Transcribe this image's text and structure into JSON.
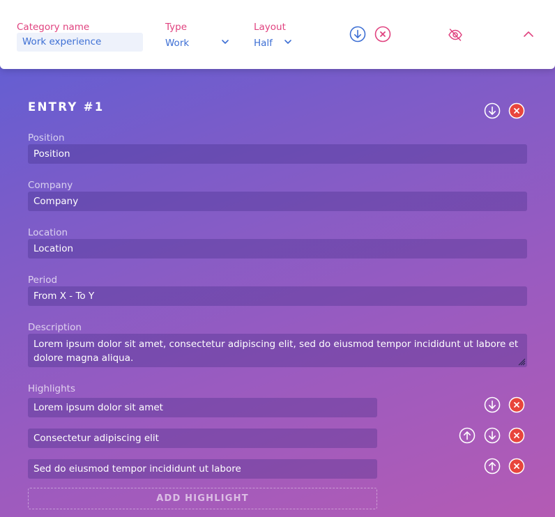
{
  "category": {
    "name_label": "Category name",
    "name_value": "Work experience",
    "type_label": "Type",
    "type_value": "Work",
    "layout_label": "Layout",
    "layout_value": "Half"
  },
  "entry": {
    "title": "ENTRY #1",
    "fields": {
      "position": {
        "label": "Position",
        "value": "Position"
      },
      "company": {
        "label": "Company",
        "value": "Company"
      },
      "location": {
        "label": "Location",
        "value": "Location"
      },
      "period": {
        "label": "Period",
        "value": "From X - To Y"
      },
      "description": {
        "label": "Description",
        "value": "Lorem ipsum dolor sit amet, consectetur adipiscing elit, sed do eiusmod tempor incididunt ut labore et dolore magna aliqua."
      }
    },
    "highlights_label": "Highlights",
    "highlights": [
      "Lorem ipsum dolor sit amet",
      "Consectetur adipiscing elit",
      "Sed do eiusmod tempor incididunt ut labore"
    ],
    "add_highlight_label": "ADD HIGHLIGHT"
  },
  "icons": {
    "move_down": "arrow-down-circle-icon",
    "move_up": "arrow-up-circle-icon",
    "remove": "close-circle-icon",
    "hide": "eye-off-icon",
    "collapse": "chevron-up-icon",
    "dropdown": "chevron-down-icon"
  },
  "colors": {
    "accent_pink": "#e0427f",
    "accent_blue": "#3d6fd4",
    "delete_red": "#e8453c"
  }
}
